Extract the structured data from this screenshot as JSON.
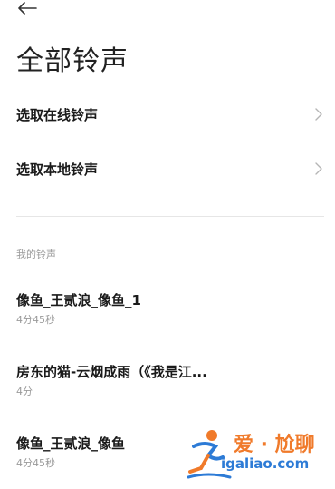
{
  "header": {
    "back_icon": "arrow-left-icon",
    "title": "全部铃声"
  },
  "options": [
    {
      "label": "选取在线铃声",
      "icon": "chevron-right-icon"
    },
    {
      "label": "选取本地铃声",
      "icon": "chevron-right-icon"
    }
  ],
  "section_title": "我的铃声",
  "ringtones": [
    {
      "name": "像鱼_王贰浪_像鱼_1",
      "duration": "4分45秒"
    },
    {
      "name": "房东的猫-云烟成雨（《我是江...",
      "duration": "4分"
    },
    {
      "name": "像鱼_王贰浪_像鱼",
      "duration": "4分45秒"
    }
  ],
  "watermark": {
    "line1": "爱 · 尬聊",
    "line2": "igaliao.com",
    "colors": {
      "orange": "#f07a2a",
      "blue": "#2d7bd6"
    }
  }
}
